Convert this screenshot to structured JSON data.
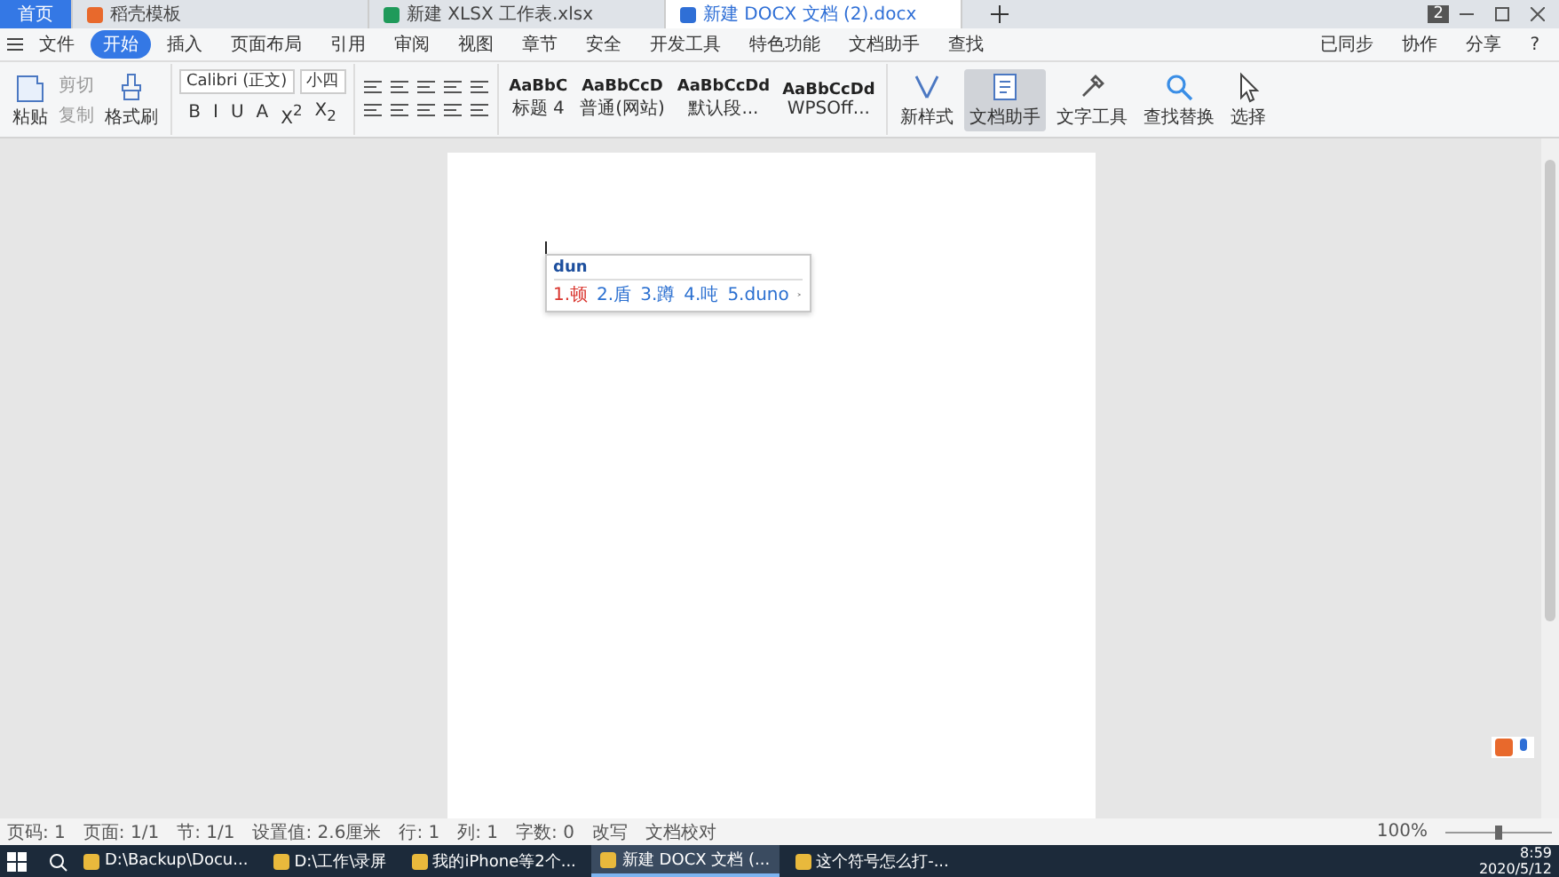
{
  "tabs": [
    {
      "label": "首页",
      "selected": false,
      "kind": "home"
    },
    {
      "label": "稻壳模板",
      "selected": false,
      "kind": "doc"
    },
    {
      "label": "新建 XLSX 工作表.xlsx",
      "selected": false,
      "kind": "sheet"
    },
    {
      "label": "新建 DOCX 文档 (2).docx",
      "selected": true,
      "kind": "word"
    }
  ],
  "title_bar": {
    "badge": "2"
  },
  "menu": {
    "file": "文件",
    "items": [
      {
        "label": "开始",
        "selected": true
      },
      {
        "label": "插入",
        "selected": false
      },
      {
        "label": "页面布局",
        "selected": false
      },
      {
        "label": "引用",
        "selected": false
      },
      {
        "label": "审阅",
        "selected": false
      },
      {
        "label": "视图",
        "selected": false
      },
      {
        "label": "章节",
        "selected": false
      },
      {
        "label": "安全",
        "selected": false
      },
      {
        "label": "开发工具",
        "selected": false
      },
      {
        "label": "特色功能",
        "selected": false
      },
      {
        "label": "文档助手",
        "selected": false
      }
    ],
    "search": "查找",
    "right": [
      "已同步",
      "协作",
      "分享"
    ],
    "help": "?"
  },
  "ribbon": {
    "paste": "粘贴",
    "cut": "剪切",
    "copy": "复制",
    "format_painter": "格式刷",
    "font_name": "Calibri (正文)",
    "font_size": "小四",
    "font_buttons": [
      "B",
      "I",
      "U",
      "A",
      "X$^{2}$",
      "X$_{2}$"
    ],
    "styles": [
      {
        "sample": "AaBbC",
        "name": "标题 4"
      },
      {
        "sample": "AaBbCcD",
        "name": "普通(网站)"
      },
      {
        "sample": "AaBbCcDd",
        "name": "默认段..."
      },
      {
        "sample": "AaBbCcDd",
        "name": "WPSOff..."
      }
    ],
    "tools": [
      {
        "label": "新样式",
        "selected": false
      },
      {
        "label": "文档助手",
        "selected": true
      },
      {
        "label": "文字工具",
        "selected": false
      },
      {
        "label": "查找替换",
        "selected": false
      },
      {
        "label": "选择",
        "selected": false
      }
    ]
  },
  "ime": {
    "input": "dun",
    "candidates": [
      {
        "text": "1.顿",
        "selected": true
      },
      {
        "text": "2.盾",
        "selected": false
      },
      {
        "text": "3.蹲",
        "selected": false
      },
      {
        "text": "4.吨",
        "selected": false
      },
      {
        "text": "5.duno",
        "selected": false
      }
    ]
  },
  "status_bar": {
    "items": [
      "页码: 1",
      "页面: 1/1",
      "节: 1/1",
      "设置值: 2.6厘米",
      "行: 1",
      "列: 1",
      "字数: 0",
      "改写",
      "文档校对"
    ],
    "zoom": "100%"
  },
  "taskbar": {
    "items": [
      {
        "label": "D:\\Backup\\Docu...",
        "selected": false
      },
      {
        "label": "D:\\工作\\录屏",
        "selected": false
      },
      {
        "label": "我的iPhone等2个...",
        "selected": false
      },
      {
        "label": "新建 DOCX 文档 (...",
        "selected": true
      },
      {
        "label": "这个符号怎么打-...",
        "selected": false
      }
    ],
    "time": "8:59",
    "date": "2020/5/12"
  }
}
